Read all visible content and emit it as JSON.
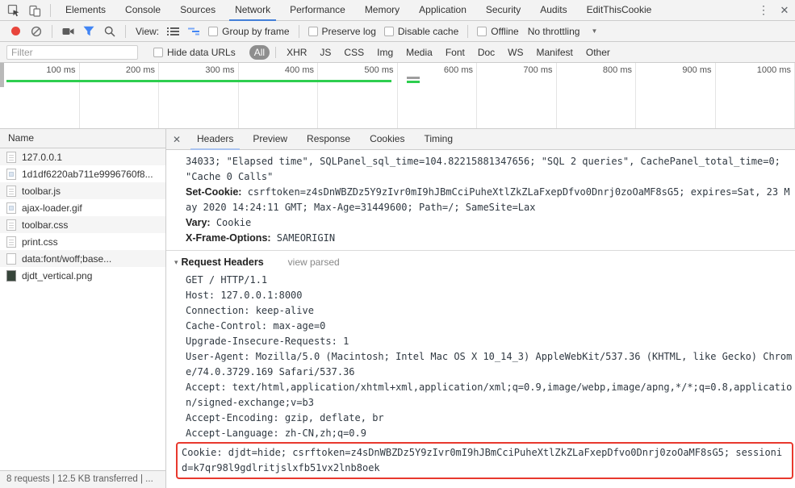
{
  "window": {
    "menu_glyph": "⋮",
    "close_glyph": "✕"
  },
  "top_tabs": {
    "tabs": [
      "Elements",
      "Console",
      "Sources",
      "Network",
      "Performance",
      "Memory",
      "Application",
      "Security",
      "Audits",
      "EditThisCookie"
    ],
    "active": "Network"
  },
  "toolbar": {
    "view_label": "View:",
    "group_by_frame": "Group by frame",
    "preserve_log": "Preserve log",
    "disable_cache": "Disable cache",
    "offline": "Offline",
    "throttling": "No throttling",
    "dropdown_arrow": "▼",
    "record_color": "#E8453C",
    "filter_icon_color": "#4285F4"
  },
  "filter_bar": {
    "placeholder": "Filter",
    "hide_data_urls": "Hide data URLs",
    "types": [
      "All",
      "XHR",
      "JS",
      "CSS",
      "Img",
      "Media",
      "Font",
      "Doc",
      "WS",
      "Manifest",
      "Other"
    ],
    "active_type": "All"
  },
  "overview": {
    "ticks": [
      "100 ms",
      "200 ms",
      "300 ms",
      "400 ms",
      "500 ms",
      "600 ms",
      "700 ms",
      "800 ms",
      "900 ms",
      "1000 ms"
    ],
    "load_line_color": "#2ECE4F"
  },
  "sidebar": {
    "header": "Name",
    "rows": [
      {
        "label": "127.0.0.1",
        "icon": "document",
        "selected": true
      },
      {
        "label": "1d1df6220ab711e9996760f8...",
        "icon": "image",
        "selected": false
      },
      {
        "label": "toolbar.js",
        "icon": "document",
        "selected": false
      },
      {
        "label": "ajax-loader.gif",
        "icon": "image",
        "selected": false
      },
      {
        "label": "toolbar.css",
        "icon": "document",
        "selected": false
      },
      {
        "label": "print.css",
        "icon": "document",
        "selected": false
      },
      {
        "label": "data:font/woff;base...",
        "icon": "blank",
        "selected": false
      },
      {
        "label": "djdt_vertical.png",
        "icon": "thumbnail-dark",
        "selected": false
      }
    ]
  },
  "details": {
    "close_glyph": "✕",
    "tabs": [
      "Headers",
      "Preview",
      "Response",
      "Cookies",
      "Timing"
    ],
    "active_tab": "Headers",
    "response_lines": [
      {
        "type": "mono",
        "text": "34033; \"Elapsed time\", SQLPanel_sql_time=104.82215881347656; \"SQL 2 queries\", CachePanel_total_time=0; \"Cache 0 Calls\""
      },
      {
        "type": "header",
        "name": "Set-Cookie:",
        "value": "csrftoken=z4sDnWBZDz5Y9zIvr0mI9hJBmCciPuheXtlZkZLaFxepDfvo0Dnrj0zoOaMF8sG5; expires=Sat, 23 May 2020 14:24:11 GMT; Max-Age=31449600; Path=/; SameSite=Lax"
      },
      {
        "type": "header",
        "name": "Vary:",
        "value": "Cookie"
      },
      {
        "type": "header",
        "name": "X-Frame-Options:",
        "value": "SAMEORIGIN"
      }
    ],
    "request_headers": {
      "toggle": "▾",
      "title": "Request Headers",
      "link": "view parsed",
      "raw_lines": [
        "GET / HTTP/1.1",
        "Host: 127.0.0.1:8000",
        "Connection: keep-alive",
        "Cache-Control: max-age=0",
        "Upgrade-Insecure-Requests: 1",
        "User-Agent: Mozilla/5.0 (Macintosh; Intel Mac OS X 10_14_3) AppleWebKit/537.36 (KHTML, like Gecko) Chrome/74.0.3729.169 Safari/537.36",
        "Accept: text/html,application/xhtml+xml,application/xml;q=0.9,image/webp,image/apng,*/*;q=0.8,application/signed-exchange;v=b3",
        "Accept-Encoding: gzip, deflate, br",
        "Accept-Language: zh-CN,zh;q=0.9"
      ],
      "highlighted_line": "Cookie: djdt=hide; csrftoken=z4sDnWBZDz5Y9zIvr0mI9hJBmCciPuheXtlZkZLaFxepDfvo0Dnrj0zoOaMF8sG5; sessionid=k7qr98l9gdlritjslxfb51vx2lnb8oek",
      "highlight_color": "#E8392E"
    }
  },
  "status_bar": {
    "text": "8 requests | 12.5 KB transferred | ..."
  }
}
